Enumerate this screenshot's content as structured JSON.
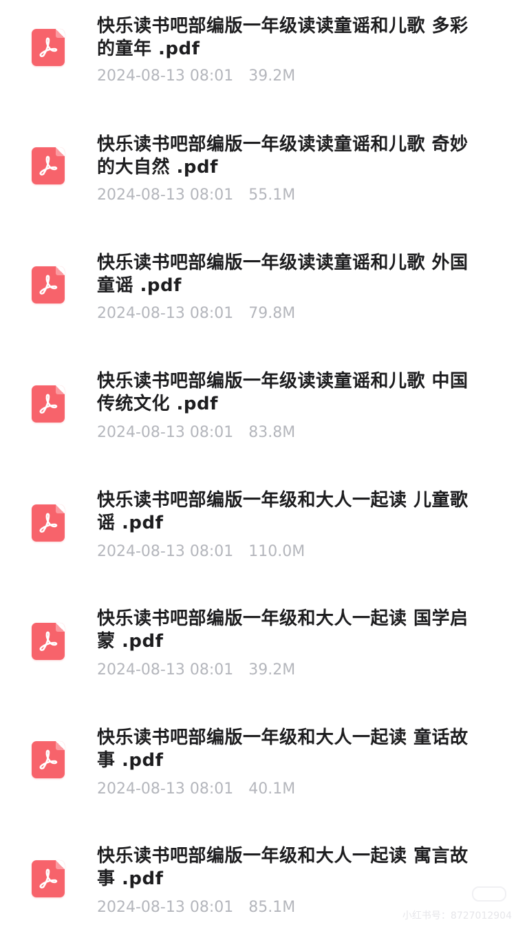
{
  "files": [
    {
      "name": "快乐读书吧部编版一年级读读童谣和儿歌 多彩的童年 .pdf",
      "date": "2024-08-13 08:01",
      "size": "39.2M",
      "icon": "pdf-icon"
    },
    {
      "name": "快乐读书吧部编版一年级读读童谣和儿歌 奇妙的大自然 .pdf",
      "date": "2024-08-13 08:01",
      "size": "55.1M",
      "icon": "pdf-icon"
    },
    {
      "name": "快乐读书吧部编版一年级读读童谣和儿歌 外国童谣 .pdf",
      "date": "2024-08-13 08:01",
      "size": "79.8M",
      "icon": "pdf-icon"
    },
    {
      "name": "快乐读书吧部编版一年级读读童谣和儿歌 中国传统文化 .pdf",
      "date": "2024-08-13 08:01",
      "size": "83.8M",
      "icon": "pdf-icon"
    },
    {
      "name": "快乐读书吧部编版一年级和大人一起读 儿童歌谣 .pdf",
      "date": "2024-08-13 08:01",
      "size": "110.0M",
      "icon": "pdf-icon"
    },
    {
      "name": "快乐读书吧部编版一年级和大人一起读 国学启蒙 .pdf",
      "date": "2024-08-13 08:01",
      "size": "39.2M",
      "icon": "pdf-icon"
    },
    {
      "name": "快乐读书吧部编版一年级和大人一起读 童话故事 .pdf",
      "date": "2024-08-13 08:01",
      "size": "40.1M",
      "icon": "pdf-icon"
    },
    {
      "name": "快乐读书吧部编版一年级和大人一起读 寓言故事 .pdf",
      "date": "2024-08-13 08:01",
      "size": "85.1M",
      "icon": "pdf-icon"
    }
  ],
  "watermark": "小红书号：8727012904",
  "colors": {
    "icon_background": "#f7636b",
    "title_text": "#1d1d1f",
    "meta_text": "#b4b6bc"
  }
}
